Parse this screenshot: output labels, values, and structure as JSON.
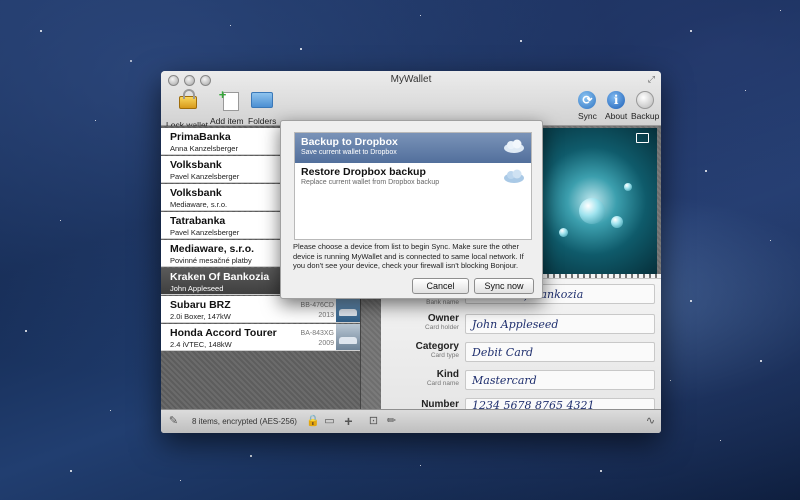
{
  "window": {
    "title": "MyWallet"
  },
  "toolbar": {
    "lock_wallet": "Lock wallet",
    "add_item": "Add item",
    "folders": "Folders",
    "sync": "Sync",
    "about": "About",
    "backup": "Backup"
  },
  "items": [
    {
      "name": "PrimaBanka",
      "sub": "Anna Kanzelsberger"
    },
    {
      "name": "Volksbank",
      "sub": "Pavel Kanzelsberger"
    },
    {
      "name": "Volksbank",
      "sub": "Mediaware, s.r.o."
    },
    {
      "name": "Tatrabanka",
      "sub": "Pavel Kanzelsberger"
    },
    {
      "name": "Mediaware, s.r.o.",
      "sub": "Povinné mesačné platby"
    },
    {
      "name": "Kraken Of Bankozia",
      "sub": "John Appleseed"
    },
    {
      "name": "Subaru BRZ",
      "sub": "2.0i Boxer, 147kW",
      "plate": "BB-476CD",
      "year": "2013"
    },
    {
      "name": "Honda Accord Tourer",
      "sub": "2.4 iVTEC, 148kW",
      "plate": "BA-843XG",
      "year": "2009"
    }
  ],
  "details": {
    "bank_value": "Kraken Of Bankozia",
    "bank_sublabel": "Bank name",
    "owner_label": "Owner",
    "owner_sublabel": "Card holder",
    "owner_value": "John Appleseed",
    "category_label": "Category",
    "category_sublabel": "Card type",
    "category_value": "Debit Card",
    "kind_label": "Kind",
    "kind_sublabel": "Card name",
    "kind_value": "Mastercard",
    "number_label": "Number",
    "number_value": "1234 5678 8765 4321"
  },
  "status": {
    "text": "8 items, encrypted (AES-256)"
  },
  "popover": {
    "options": [
      {
        "title": "Backup to Dropbox",
        "subtitle": "Save current wallet to Dropbox"
      },
      {
        "title": "Restore Dropbox backup",
        "subtitle": "Replace current wallet from Dropbox backup"
      }
    ],
    "message": "Please choose a device from list to begin Sync. Make sure the other device is running MyWallet and is connected to same local network. If you don't see your device, check your firewall isn't blocking Bonjour.",
    "cancel": "Cancel",
    "sync_now": "Sync now"
  },
  "colors": {
    "selection": "#4a4a4a",
    "popover_selection": "#5f7ba6",
    "handwriting": "#1f2f6e"
  }
}
